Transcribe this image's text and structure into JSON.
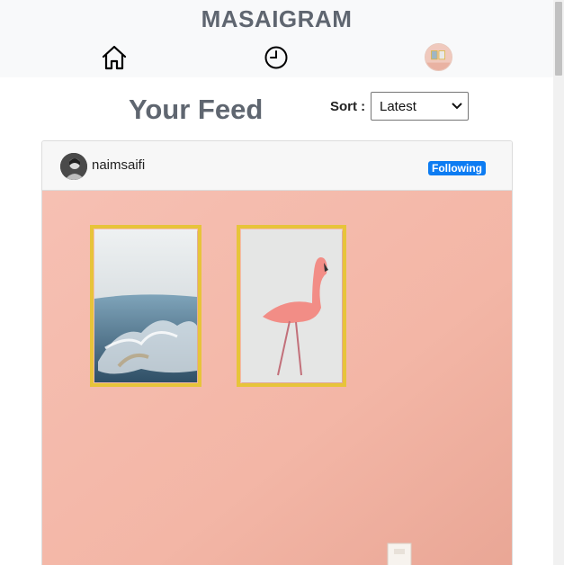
{
  "app": {
    "title": "MASAIGRAM"
  },
  "nav": {
    "items": [
      {
        "icon": "home-icon"
      },
      {
        "icon": "clock-icon"
      },
      {
        "icon": "profile-avatar"
      }
    ]
  },
  "feed": {
    "title": "Your Feed",
    "sort": {
      "label": "Sort :",
      "selected": "Latest"
    }
  },
  "post": {
    "username": "naimsaifi",
    "follow_status": "Following",
    "colors": {
      "badge": "#0d7cf2",
      "wall": "#f2b6a6",
      "frame": "#e7c43a"
    }
  }
}
